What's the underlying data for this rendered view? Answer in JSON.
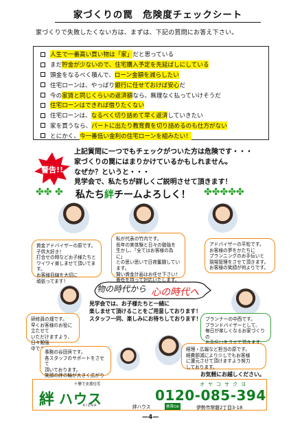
{
  "title": "家づくりの罠　危険度チェックシート",
  "intro": "家づくりで失敗したくない方は、まずは、下記の質問にお答え下さい。",
  "checklist": [
    {
      "plain_prefix": "",
      "highlight": "人生で一番高い買い物は「家」",
      "plain_suffix": "だと思っている"
    },
    {
      "plain_prefix": "まだ",
      "highlight": "貯金が少ないので、住宅購入予定を先延ばしにしている",
      "plain_suffix": ""
    },
    {
      "plain_prefix": "頭金をなるべく積んで、",
      "highlight": "ローン金額を減らしたい",
      "plain_suffix": ""
    },
    {
      "plain_prefix": "住宅ローンは、やっぱり",
      "highlight": "銀行に任せておけば安心",
      "plain_suffix": "だ"
    },
    {
      "plain_prefix": "今の",
      "highlight": "家賃と同じくらいの返済額",
      "plain_suffix": "なら、無理なく払っていけそうだ"
    },
    {
      "plain_prefix": "",
      "highlight": "住宅ローンはできれば借りたくない",
      "plain_suffix": ""
    },
    {
      "plain_prefix": "住宅ローンは、",
      "highlight": "なるべく切り詰めて早く返済",
      "plain_suffix": "していきたい"
    },
    {
      "plain_prefix": "家を買うなら、",
      "highlight": "パートに出たり教育費を切り詰めるのも仕方がない",
      "plain_suffix": ""
    },
    {
      "plain_prefix": "とにかく、",
      "highlight": "今一番低い金利の住宅ローンを組みたい！",
      "plain_suffix": ""
    }
  ],
  "warning": {
    "badge": "警告!!",
    "lines": [
      "上記質問に一つでもチェックがついた方は危険です・・・",
      "家づくりの罠にはまりかけているかもしれません。",
      "なぜか？というと・・・",
      "見学会で、私たちが詳しくご説明させて頂きます！"
    ]
  },
  "team": {
    "prefix": "私たち",
    "brand": "絆",
    "suffix": "チームよろしく！"
  },
  "bubbles": {
    "advisor_left": "資金アドバイザーの原です。\n子供大好き！\n打合せの時などお子様たちと\nワイワイ楽しませて頂いてます。\nお客様目線を大切に\n頑張ってます！",
    "ceo": "私が代表の竹内です。\n長年の実体験と日々の勉強を\n生かし、「全てはお客様の為に」\nとの思い思いで日夜奮闘しています。\n賢い資金計画はお任せ下さい！\n責任を持って対応いたします。",
    "advisor_right": "アドバイザーの平松です。\nお客様の夢をかたちに\nプランニングのお手伝いと\n現場管理をさせて頂きます。\nお客様の笑顔が何よりです。",
    "member_left": "研修員の畑です。\n早くお客様のお役に立たせて\nいただけますよう、日々勉強\n中です！！",
    "planner": "プランナーの中西です。\nブランドバイザーとして、\n毎日が楽しくなるお家づくりの\nお手伝いをさせて頂きます。",
    "office": "事務の谷田貝です。\n各スタッフのサポートをさせて\n頂いております。\n笑顔の絆の輪が大きく広がり\nますように！",
    "accounting": "経理・広報など担当の原です。\n経費節減により少しでもお客様\nに還元させて頂けますよう努力\nしております。"
  },
  "era": {
    "left": "物の時代から",
    "right": "心の時代へ"
  },
  "center_note": "見学会では、お子様たちと一緒に\n楽しませて頂けることをご用意しております！\nスタッフ一同、楽しみにお待ちしております！",
  "sign_off": "お気軽にお越しください。",
  "footer": {
    "logo_top": "十勝で支援住宅",
    "logo_kanji": "絆",
    "logo_kana": "ハウス",
    "logo_bottom": "KIZNA",
    "phone_kana": "オヤコサクヨ",
    "phone": "0120-085-394",
    "brand_small": "絆ハウス",
    "badge": "携帯OK",
    "address": "伊勢市常磐2丁目3-18"
  },
  "page_number": "—4—",
  "colors": {
    "highlight": "#fff000",
    "accent_orange": "#f08a12",
    "accent_green": "#0e7f21",
    "warning_red": "#e4001b"
  },
  "icons": [
    "clover-icon",
    "warning-star-icon",
    "person-photo-icon"
  ]
}
